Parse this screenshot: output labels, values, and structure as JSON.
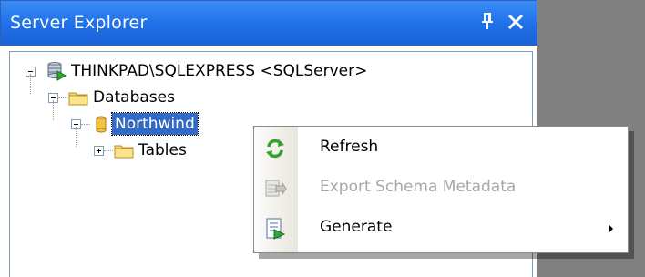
{
  "panel": {
    "title": "Server Explorer",
    "pin_glyph": "⬍",
    "close_glyph": "X"
  },
  "tree": {
    "server": {
      "label": "THINKPAD\\SQLEXPRESS <SQLServer>",
      "icon": "database-server-icon"
    },
    "databases": {
      "label": "Databases",
      "icon": "folder-icon"
    },
    "northwind": {
      "label": "Northwind",
      "icon": "database-icon",
      "selected": true
    },
    "tables": {
      "label": "Tables",
      "icon": "folder-icon"
    }
  },
  "context_menu": {
    "items": [
      {
        "label": "Refresh",
        "icon": "refresh-icon",
        "enabled": true,
        "submenu": false
      },
      {
        "label": "Export Schema Metadata",
        "icon": "export-schema-icon",
        "enabled": false,
        "submenu": false
      },
      {
        "label": "Generate",
        "icon": "generate-icon",
        "enabled": true,
        "submenu": true
      }
    ]
  },
  "colors": {
    "title_bar": "#1f6fe8",
    "selection": "#316ac5",
    "disabled_text": "#a7a6aa",
    "gutter": "#e9e6dc"
  }
}
